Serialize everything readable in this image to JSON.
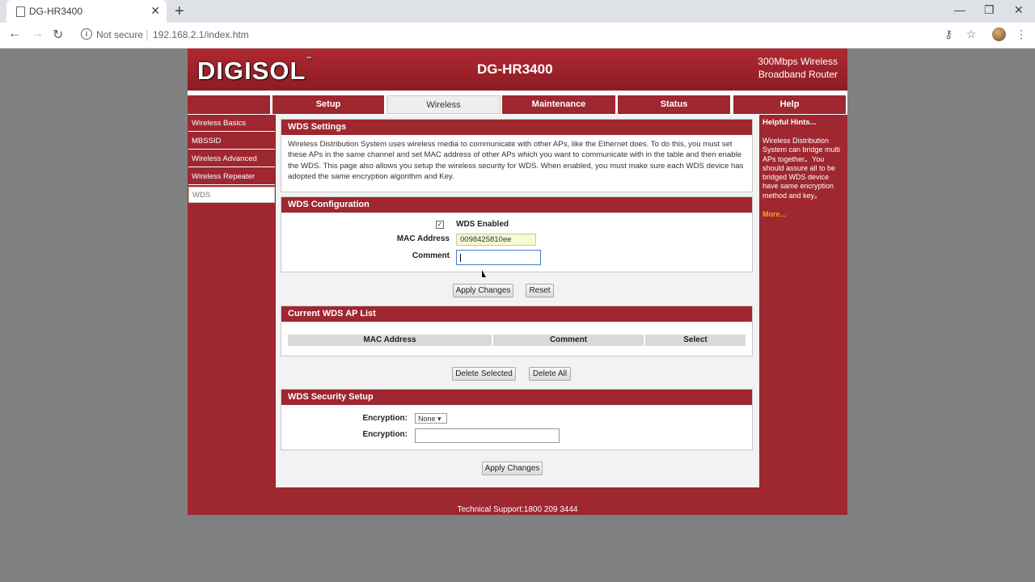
{
  "browser": {
    "tab_title": "DG-HR3400",
    "new_tab": "+",
    "not_secure": "Not secure",
    "url": "192.168.2.1/index.htm",
    "minimize": "—",
    "maximize": "❐",
    "close": "✕"
  },
  "header": {
    "logo": "DIGISOL",
    "model": "DG-HR3400",
    "tagline_line1": "300Mbps Wireless",
    "tagline_line2": "Broadband Router"
  },
  "topnav": [
    "Setup",
    "Wireless",
    "Maintenance",
    "Status",
    "Help"
  ],
  "sidebar": {
    "items": [
      {
        "label": "Wireless Basics"
      },
      {
        "label": "MBSSID"
      },
      {
        "label": "Wireless Advanced"
      },
      {
        "label": "Wireless Repeater"
      },
      {
        "label": "WDS"
      }
    ]
  },
  "wds_settings": {
    "title": "WDS Settings",
    "description": "Wireless Distribution System uses wireless media to communicate with other APs, like the Ethernet does. To do this, you must set these APs in the same channel and set MAC address of other APs which you want to communicate with in the table and then enable the WDS. This page also allows you setup the wireless security for WDS. When enabled, you must make sure each WDS device has adopted the same encryption algorithm and Key."
  },
  "wds_config": {
    "title": "WDS Configuration",
    "enabled_label": "WDS Enabled",
    "enabled_checked": true,
    "mac_label": "MAC Address",
    "mac_value": "0098425810ee",
    "comment_label": "Comment",
    "comment_value": "",
    "apply_label": "Apply Changes",
    "reset_label": "Reset"
  },
  "ap_list": {
    "title": "Current WDS AP List",
    "columns": [
      "MAC Address",
      "Comment",
      "Select"
    ],
    "rows": [],
    "delete_selected_label": "Delete Selected",
    "delete_all_label": "Delete All"
  },
  "security": {
    "title": "WDS Security Setup",
    "encryption_label": "Encryption:",
    "encryption_value": "None",
    "key_label": "Encryption:",
    "key_value": "",
    "apply_label": "Apply Changes"
  },
  "hints": {
    "title": "Helpful Hints...",
    "body": "Wireless Distribution System can bridge multi APs together。You should assure all to be bridged WDS device have same encryption method and key。",
    "more": "More..."
  },
  "footer": {
    "support": "Technical Support:1800 209 3444"
  },
  "colors": {
    "brand_red": "#9e2730",
    "hint_link": "#f5a623"
  }
}
